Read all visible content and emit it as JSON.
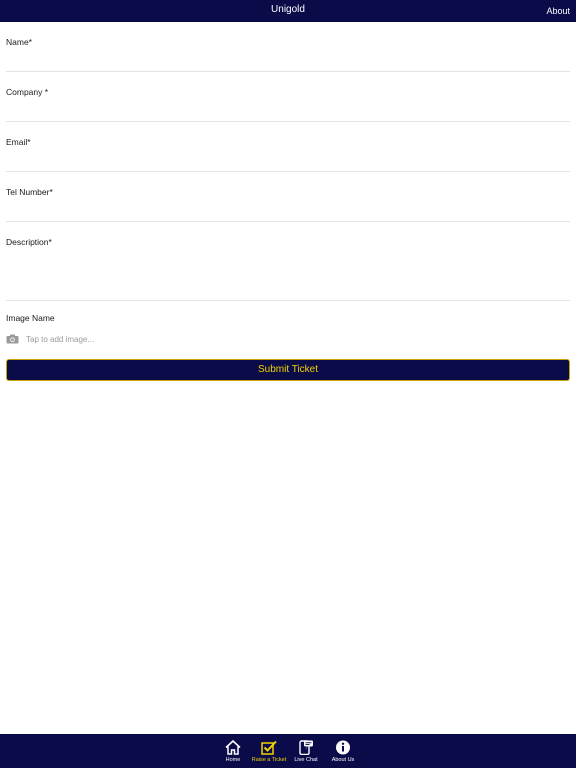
{
  "header": {
    "title": "Unigold",
    "about_label": "About"
  },
  "form": {
    "fields": [
      {
        "label": "Name*"
      },
      {
        "label": "Company *"
      },
      {
        "label": "Email*"
      },
      {
        "label": "Tel Number*"
      },
      {
        "label": "Description*"
      }
    ],
    "image_name_label": "Image Name",
    "image_hint": "Tap to add image...",
    "submit_label": "Submit Ticket"
  },
  "tabbar": {
    "items": [
      {
        "label": "Home",
        "icon": "home-icon"
      },
      {
        "label": "Raise a Ticket",
        "icon": "checkbox-icon",
        "active": true
      },
      {
        "label": "Live Chat",
        "icon": "chat-phone-icon"
      },
      {
        "label": "About Us",
        "icon": "info-icon"
      }
    ]
  },
  "colors": {
    "navy": "#0b0b4a",
    "accent_yellow": "#f2d400"
  }
}
